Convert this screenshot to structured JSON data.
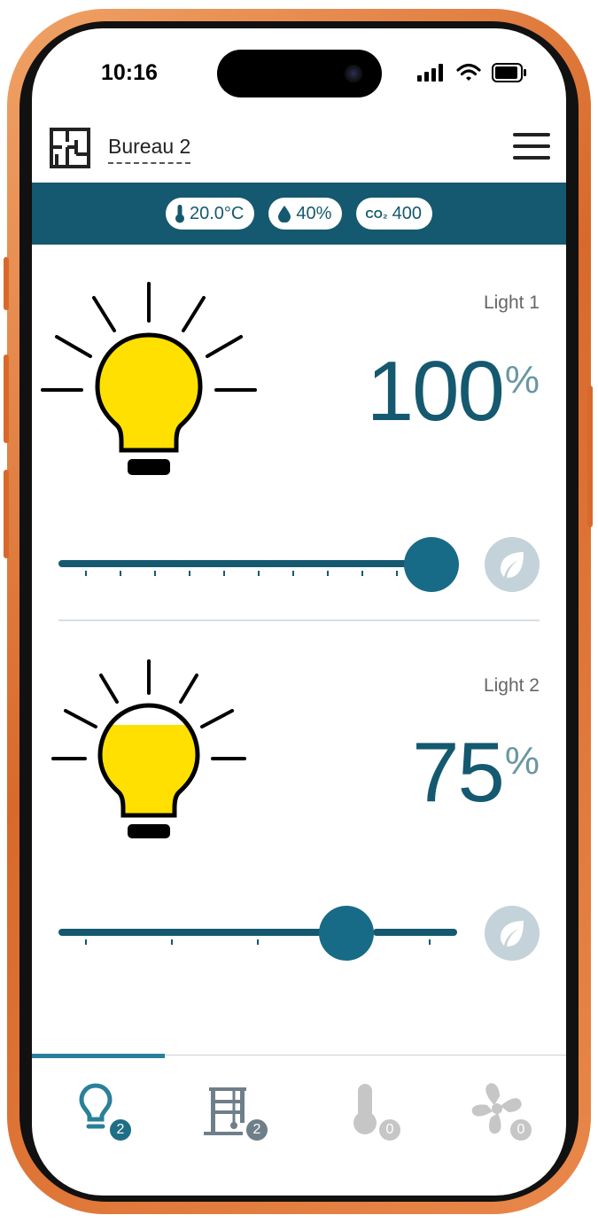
{
  "status_bar": {
    "time": "10:16"
  },
  "header": {
    "room_name": "Bureau 2"
  },
  "sensors": {
    "temperature": "20.0°C",
    "humidity": "40%",
    "co2": "400",
    "co2_label": "CO₂"
  },
  "lights": [
    {
      "name": "Light 1",
      "value": "100",
      "unit": "%",
      "level": 1.0
    },
    {
      "name": "Light 2",
      "value": "75",
      "unit": "%",
      "level": 0.75
    }
  ],
  "nav": [
    {
      "icon": "light-bulb-icon",
      "badge": "2",
      "active": true
    },
    {
      "icon": "window-shade-icon",
      "badge": "2",
      "active": false
    },
    {
      "icon": "thermometer-icon",
      "badge": "0",
      "active": false
    },
    {
      "icon": "fan-icon",
      "badge": "0",
      "active": false
    }
  ],
  "colors": {
    "primary": "#14596f",
    "bulb_fill": "#ffe000",
    "nav_active": "#2a7f99",
    "nav_shade": "#6e7f89",
    "nav_disabled": "#c6c6c6"
  }
}
